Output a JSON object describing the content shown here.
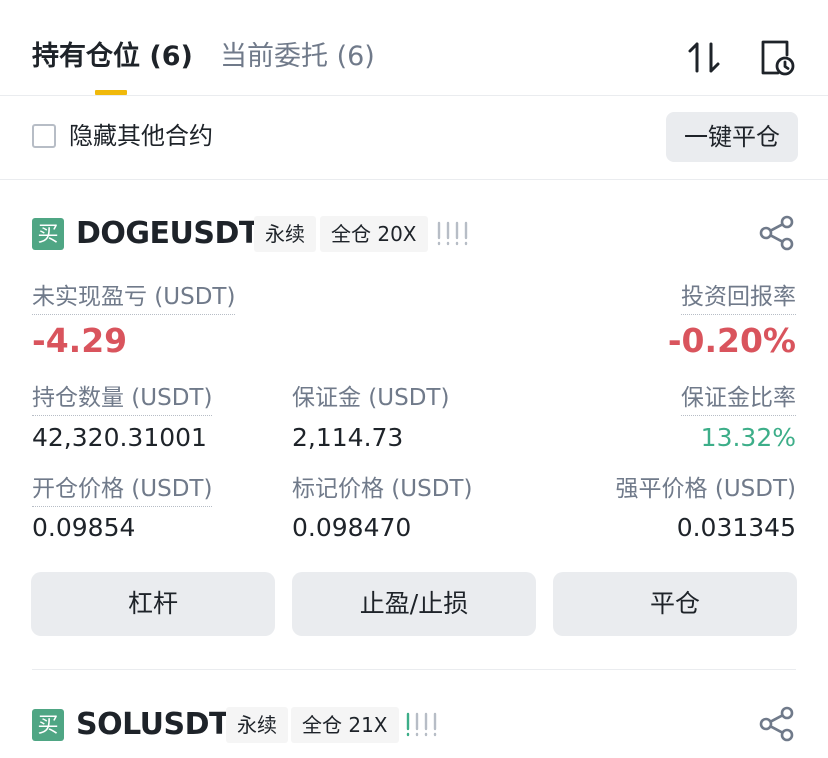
{
  "tabs": [
    {
      "label": "持有仓位 (6)",
      "active": true
    },
    {
      "label": "当前委托 (6)",
      "active": false
    }
  ],
  "header_icons": [
    "sort-icon",
    "history-icon"
  ],
  "filter": {
    "hide_other_label": "隐藏其他合约",
    "hide_other_checked": false,
    "close_all_label": "一键平仓"
  },
  "positions": [
    {
      "side_badge": "买",
      "symbol": "DOGEUSDT",
      "type_tag": "永续",
      "margin_tag": "全仓 20X",
      "risk_indicator": "!!!!",
      "unrealized_pnl_label": "未实现盈亏 (USDT)",
      "unrealized_pnl": "-4.29",
      "roe_label": "投资回报率",
      "roe": "-0.20%",
      "size_label": "持仓数量 (USDT)",
      "size": "42,320.31001",
      "margin_label": "保证金 (USDT)",
      "margin": "2,114.73",
      "margin_ratio_label": "保证金比率",
      "margin_ratio": "13.32%",
      "entry_price_label": "开仓价格 (USDT)",
      "entry_price": "0.09854",
      "mark_price_label": "标记价格 (USDT)",
      "mark_price": "0.098470",
      "liq_price_label": "强平价格 (USDT)",
      "liq_price": "0.031345",
      "buttons": {
        "leverage": "杠杆",
        "tpsl": "止盈/止损",
        "close": "平仓"
      }
    },
    {
      "side_badge": "买",
      "symbol": "SOLUSDT",
      "type_tag": "永续",
      "margin_tag": "全仓 21X",
      "risk_indicator": "!!!!"
    }
  ],
  "colors": {
    "accent": "#f0b90b",
    "buy": "#4fa684",
    "loss": "#d9545d",
    "profit": "#3dae89",
    "muted": "#707a8a"
  }
}
